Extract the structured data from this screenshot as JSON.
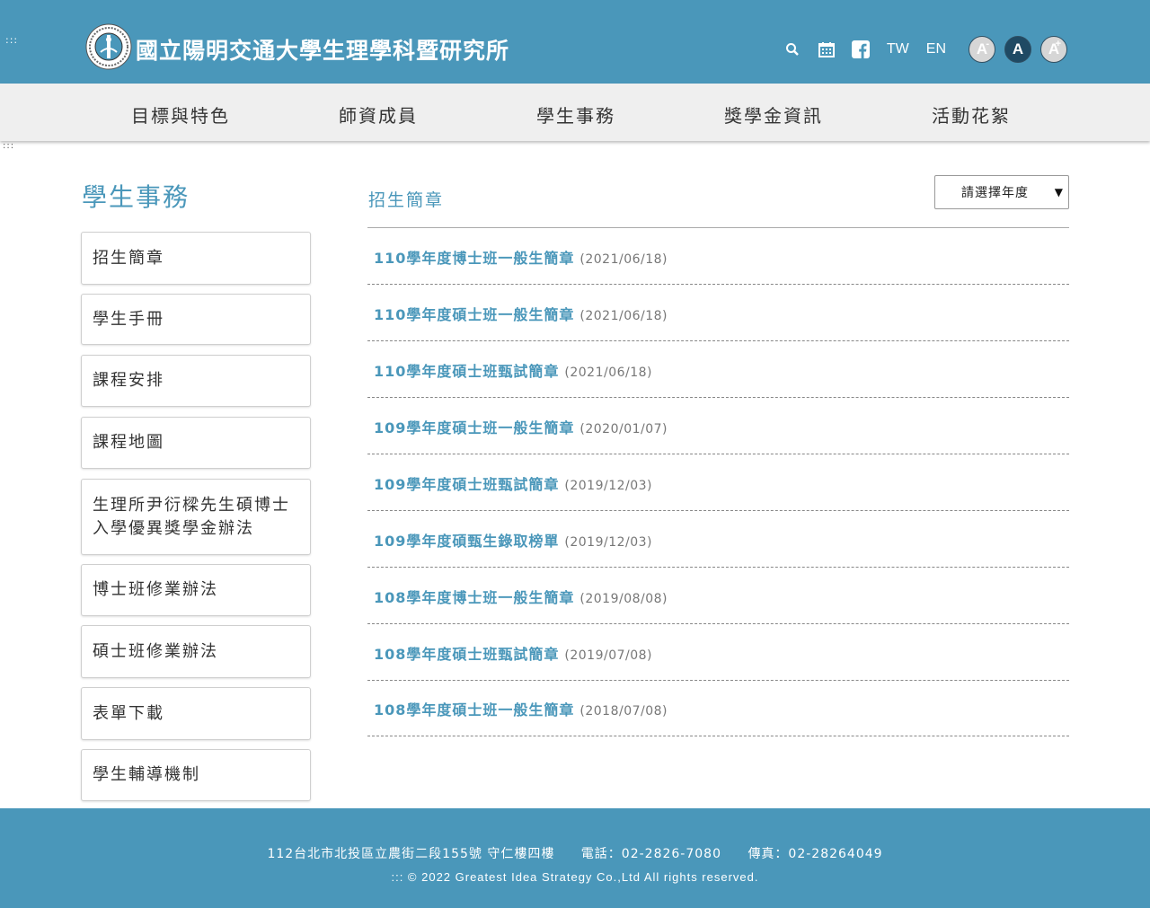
{
  "header": {
    "access_key": ":::",
    "title": "國立陽明交通大學生理學科暨研究所",
    "lang_tw": "TW",
    "lang_en": "EN",
    "font_small": "A",
    "font_small_mark": "-",
    "font_mid": "A",
    "font_large": "A",
    "font_large_mark": "+",
    "icons": [
      "search-icon",
      "calendar-icon",
      "facebook-icon"
    ],
    "bg_color": "#4a97ba"
  },
  "nav": {
    "items": [
      "目標與特色",
      "師資成員",
      "學生事務",
      "獎學金資訊",
      "活動花絮"
    ],
    "access_key": ":::"
  },
  "sidebar": {
    "title": "學生事務",
    "items": [
      "招生簡章",
      "學生手冊",
      "課程安排",
      "課程地圖",
      "生理所尹衍樑先生碩博士入學優異獎學金辦法",
      "博士班修業辦法",
      "碩士班修業辦法",
      "表單下載",
      "學生輔導機制"
    ]
  },
  "main": {
    "title": "招生簡章",
    "year_select": "請選擇年度",
    "items": [
      {
        "title": "110學年度博士班一般生簡章",
        "date": "(2021/06/18)"
      },
      {
        "title": "110學年度碩士班一般生簡章",
        "date": "(2021/06/18)"
      },
      {
        "title": "110學年度碩士班甄試簡章",
        "date": "(2021/06/18)"
      },
      {
        "title": "109學年度碩士班一般生簡章",
        "date": "(2020/01/07)"
      },
      {
        "title": "109學年度碩士班甄試簡章",
        "date": "(2019/12/03)"
      },
      {
        "title": "109學年度碩甄生錄取榜單",
        "date": "(2019/12/03)"
      },
      {
        "title": "108學年度博士班一般生簡章",
        "date": "(2019/08/08)"
      },
      {
        "title": "108學年度碩士班甄試簡章",
        "date": "(2019/07/08)"
      },
      {
        "title": "108學年度碩士班一般生簡章",
        "date": "(2018/07/08)"
      }
    ]
  },
  "footer": {
    "address": "112台北市北投區立農街二段155號 守仁樓四樓",
    "phone": "電話：02-2826-7080",
    "fax": "傳真：02-28264049",
    "copyright": "::: © 2022 Greatest Idea Strategy Co.,Ltd All rights reserved."
  }
}
